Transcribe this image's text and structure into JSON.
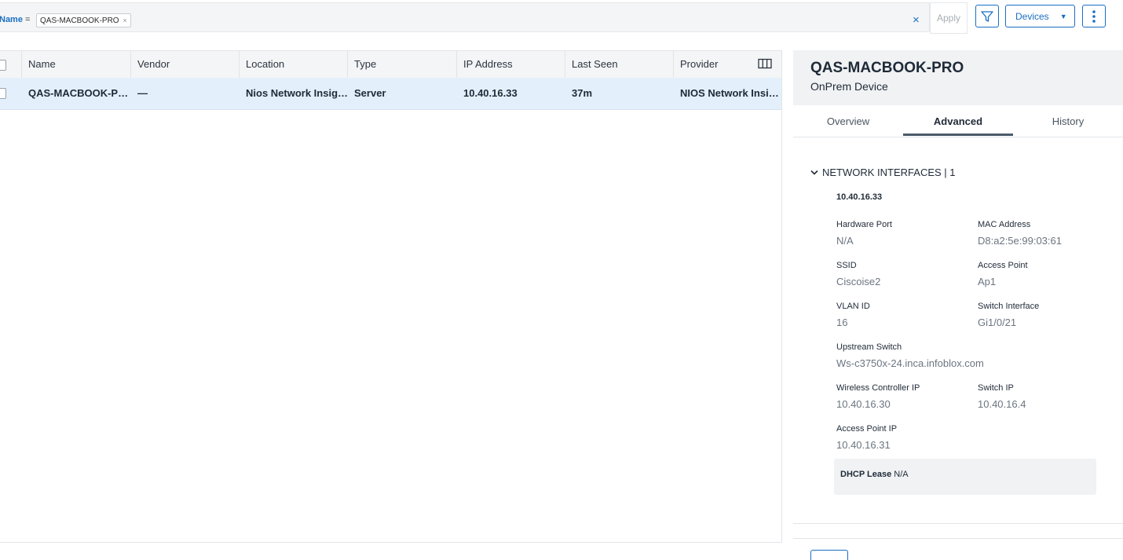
{
  "filter": {
    "field": "Name",
    "operator": "=",
    "chip_value": "QAS-MACBOOK-PRO",
    "chip_remove": "×",
    "clear": "×",
    "apply_label": "Apply"
  },
  "toolbar": {
    "devices_label": "Devices",
    "filter_icon": "funnel-icon",
    "more_icon": "kebab-menu-icon",
    "accent": "#1a6fc4"
  },
  "table": {
    "columns": [
      "Name",
      "Vendor",
      "Location",
      "Type",
      "IP Address",
      "Last Seen",
      "Provider"
    ],
    "rows": [
      {
        "name": "QAS-MACBOOK-P…",
        "vendor": "—",
        "location": "Nios Network Insig…",
        "type": "Server",
        "ip": "10.40.16.33",
        "last_seen": "37m",
        "provider": "NIOS Network Insi…"
      }
    ],
    "selected_row_color": "#e3f0fb"
  },
  "panel": {
    "title": "QAS-MACBOOK-PRO",
    "subtitle": "OnPrem Device",
    "tabs": [
      "Overview",
      "Advanced",
      "History"
    ],
    "active_tab": "Advanced",
    "section": {
      "title": "NETWORK INTERFACES | 1",
      "interface_ip": "10.40.16.33",
      "fields": {
        "hardware_port": {
          "label": "Hardware Port",
          "value": "N/A"
        },
        "mac_address": {
          "label": "MAC Address",
          "value": "D8:a2:5e:99:03:61"
        },
        "ssid": {
          "label": "SSID",
          "value": "Ciscoise2"
        },
        "access_point": {
          "label": "Access Point",
          "value": "Ap1"
        },
        "vlan_id": {
          "label": "VLAN ID",
          "value": "16"
        },
        "switch_interface": {
          "label": "Switch Interface",
          "value": "Gi1/0/21"
        },
        "upstream_switch": {
          "label": "Upstream Switch",
          "value": "Ws-c3750x-24.inca.infoblox.com"
        },
        "wireless_controller_ip": {
          "label": "Wireless Controller IP",
          "value": "10.40.16.30"
        },
        "switch_ip": {
          "label": "Switch IP",
          "value": "10.40.16.4"
        },
        "access_point_ip": {
          "label": "Access Point IP",
          "value": "10.40.16.31"
        }
      },
      "dhcp": {
        "label": "DHCP Lease",
        "value": "N/A"
      }
    }
  }
}
